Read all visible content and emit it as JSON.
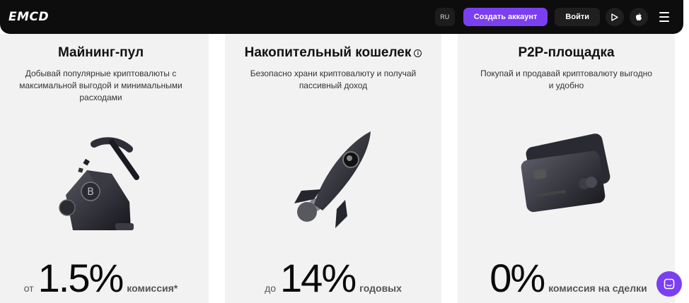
{
  "header": {
    "logo": "EMCD",
    "lang": "RU",
    "create_account": "Создать аккаунт",
    "login": "Войти",
    "icons": [
      "google-play-icon",
      "apple-icon",
      "menu-icon"
    ]
  },
  "cards": [
    {
      "title": "Майнинг-пул",
      "description": "Добывай популярные криптовалюты с максимальной выгодой и минимальными расходами",
      "stat_prefix": "от",
      "stat_value": "1.5%",
      "stat_suffix": "комиссия*",
      "illustration": "pickaxe-coins-icon"
    },
    {
      "title": "Накопительный кошелек",
      "description": "Безопасно храни криптовалюту и получай пассивный доход",
      "stat_prefix": "до",
      "stat_value": "14%",
      "stat_suffix": "годовых",
      "illustration": "rocket-icon"
    },
    {
      "title": "P2P-площадка",
      "description": "Покупай и продавай криптовалюту выгодно и удобно",
      "stat_prefix": "",
      "stat_value": "0%",
      "stat_suffix": "комиссия на сделки",
      "illustration": "credit-cards-icon"
    }
  ],
  "colors": {
    "header_bg": "#0d0d0d",
    "accent": "#7b3ff2",
    "card_bg": "#f2f2f2"
  }
}
